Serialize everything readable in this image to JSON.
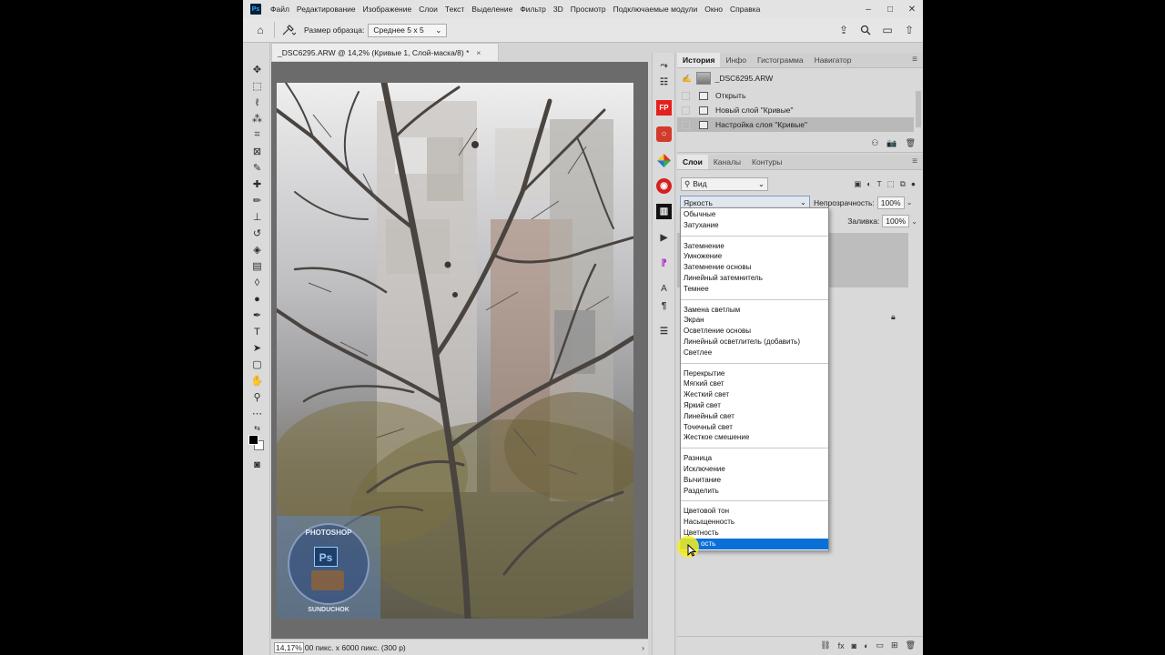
{
  "menubar": {
    "logo": "Ps",
    "items": [
      "Файл",
      "Редактирование",
      "Изображение",
      "Слои",
      "Текст",
      "Выделение",
      "Фильтр",
      "3D",
      "Просмотр",
      "Подключаемые модули",
      "Окно",
      "Справка"
    ],
    "controls": {
      "minimize": "–",
      "maximize": "□",
      "close": "✕"
    }
  },
  "options": {
    "sample_label": "Размер образца:",
    "sample_value": "Среднее 5 x 5"
  },
  "document": {
    "tab_title": "_DSC6295.ARW @ 14,2% (Кривые 1, Слой-маска/8) *",
    "close": "×",
    "watermark_top": "PHOTOSHOP",
    "watermark_logo": "Ps",
    "watermark_bottom": "SUNDUCHOK"
  },
  "status": {
    "zoom": "14,17%",
    "info": "00 пикс. x 6000 пикс. (300 р)",
    "arrow": "›"
  },
  "strip": {
    "fp_label": "FP"
  },
  "history": {
    "tabs": [
      "История",
      "Инфо",
      "Гистограмма",
      "Навигатор"
    ],
    "snapshot": "_DSC6295.ARW",
    "items": [
      "Открыть",
      "Новый слой \"Кривые\"",
      "Настройка слоя \"Кривые\""
    ]
  },
  "layers": {
    "tabs": [
      "Слои",
      "Каналы",
      "Контуры"
    ],
    "filter_value": "Вид",
    "blend_value": "Яркость",
    "opacity_label": "Непрозрачность:",
    "opacity_value": "100%",
    "fill_label": "Заливка:",
    "fill_value": "100%"
  },
  "blend_modes": {
    "group1": [
      "Обычные",
      "Затухание"
    ],
    "group2": [
      "Затемнение",
      "Умножение",
      "Затемнение основы",
      "Линейный затемнитель",
      "Темнее"
    ],
    "group3": [
      "Замена светлым",
      "Экран",
      "Осветление основы",
      "Линейный осветлитель (добавить)",
      "Светлее"
    ],
    "group4": [
      "Перекрытие",
      "Мягкий свет",
      "Жесткий свет",
      "Яркий свет",
      "Линейный свет",
      "Точечный свет",
      "Жесткое смешение"
    ],
    "group5": [
      "Разница",
      "Исключение",
      "Вычитание",
      "Разделить"
    ],
    "group6": [
      "Цветовой тон",
      "Насыщенность",
      "Цветность"
    ],
    "selected": "ость"
  }
}
